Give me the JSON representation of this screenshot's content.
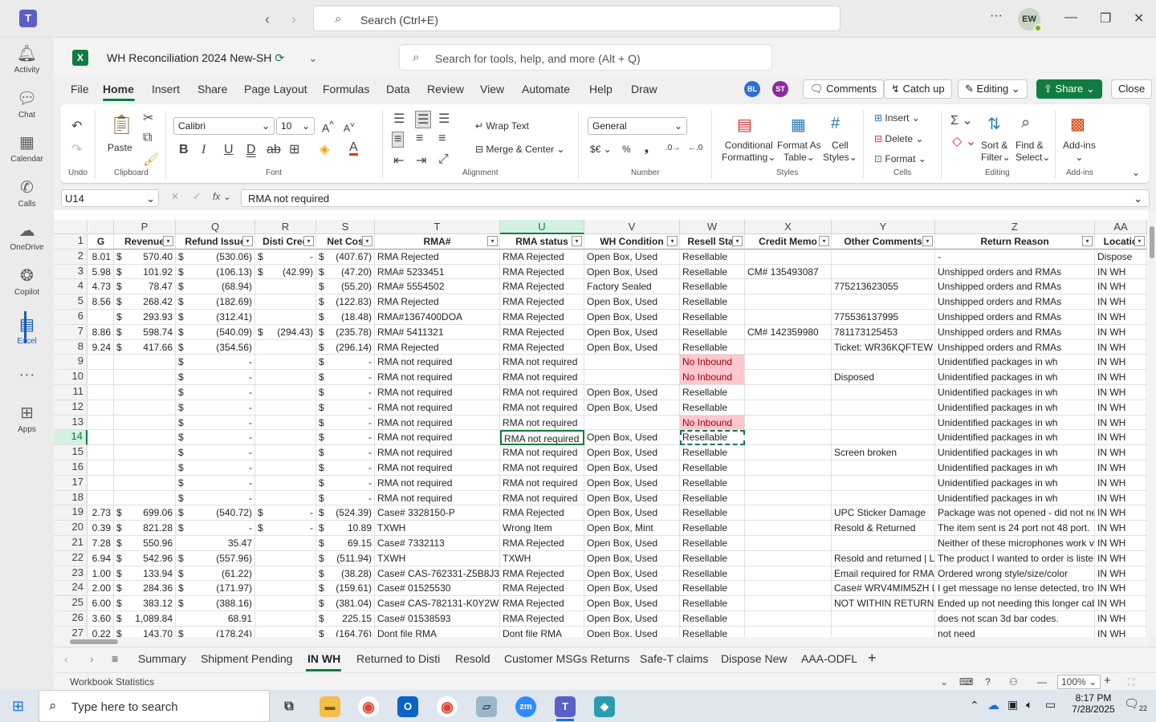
{
  "teams": {
    "search_placeholder": "Search (Ctrl+E)",
    "user_initials": "EW"
  },
  "rail": [
    {
      "label": "Activity",
      "icon": "bell-icon"
    },
    {
      "label": "Chat",
      "icon": "chat-icon"
    },
    {
      "label": "Calendar",
      "icon": "calendar-icon"
    },
    {
      "label": "Calls",
      "icon": "phone-icon"
    },
    {
      "label": "OneDrive",
      "icon": "cloud-icon"
    },
    {
      "label": "Copilot",
      "icon": "copilot-icon"
    },
    {
      "label": "Excel",
      "icon": "excel-icon"
    },
    {
      "label": "Apps",
      "icon": "apps-icon"
    }
  ],
  "workbook": {
    "title": "WH Reconciliation 2024 New-SH",
    "search_placeholder": "Search for tools, help, and more (Alt + Q)"
  },
  "ribbon_tabs": [
    "File",
    "Home",
    "Insert",
    "Share",
    "Page Layout",
    "Formulas",
    "Data",
    "Review",
    "View",
    "Automate",
    "Help",
    "Draw"
  ],
  "collab": {
    "avatar1": "BL",
    "avatar2": "ST",
    "comments": "Comments",
    "catchup": "Catch up",
    "editing": "Editing",
    "share": "Share",
    "close": "Close"
  },
  "ribbon": {
    "undo_group": "Undo",
    "paste": "Paste",
    "clipboard_group": "Clipboard",
    "font_name": "Calibri",
    "font_size": "10",
    "font_group": "Font",
    "wrap_text": "Wrap Text",
    "merge_center": "Merge & Center",
    "alignment_group": "Alignment",
    "number_format": "General",
    "number_group": "Number",
    "cond_format_1": "Conditional",
    "cond_format_2": "Formatting",
    "format_table_1": "Format As",
    "format_table_2": "Table",
    "cell_styles_1": "Cell",
    "cell_styles_2": "Styles",
    "styles_group": "Styles",
    "insert": "Insert",
    "delete": "Delete",
    "format": "Format",
    "cells_group": "Cells",
    "sort_1": "Sort &",
    "sort_2": "Filter",
    "find_1": "Find &",
    "find_2": "Select",
    "editing_group": "Editing",
    "addins": "Add-ins",
    "addins_group": "Add-ins"
  },
  "formula_bar": {
    "cell_ref": "U14",
    "content": "RMA not required"
  },
  "columns": [
    {
      "letter": "",
      "header": "G",
      "w": 32
    },
    {
      "letter": "P",
      "header": "Revenue",
      "w": 77
    },
    {
      "letter": "Q",
      "header": "Refund Issue",
      "w": 99
    },
    {
      "letter": "R",
      "header": "Disti Cred",
      "w": 76
    },
    {
      "letter": "S",
      "header": "Net Cos",
      "w": 73
    },
    {
      "letter": "T",
      "header": "RMA#",
      "w": 156
    },
    {
      "letter": "U",
      "header": "RMA status",
      "w": 105
    },
    {
      "letter": "V",
      "header": "WH Condition",
      "w": 119
    },
    {
      "letter": "W",
      "header": "Resell Stat",
      "w": 81
    },
    {
      "letter": "X",
      "header": "Credit Memo",
      "w": 108
    },
    {
      "letter": "Y",
      "header": "Other Comments",
      "w": 129
    },
    {
      "letter": "Z",
      "header": "Return Reason",
      "w": 199
    },
    {
      "letter": "AA",
      "header": "Locatio",
      "w": 65
    }
  ],
  "rows": [
    {
      "n": "2",
      "c": [
        "8.01",
        "570.40",
        "(530.06)",
        "-",
        "(407.67)",
        "RMA Rejected",
        "RMA Rejected",
        "Open Box, Used",
        "Resellable",
        "",
        "",
        "-",
        "Dispose"
      ],
      "d": [
        0,
        1,
        1,
        1,
        1
      ]
    },
    {
      "n": "3",
      "c": [
        "5.98",
        "101.92",
        "(106.13)",
        "(42.99)",
        "(47.20)",
        "RMA# 5233451",
        "RMA Rejected",
        "Open Box, Used",
        "Resellable",
        "CM# 135493087",
        "",
        "Unshipped orders and RMAs",
        "IN WH"
      ],
      "d": [
        0,
        1,
        1,
        1,
        1
      ]
    },
    {
      "n": "4",
      "c": [
        "4.73",
        "78.47",
        "(68.94)",
        "",
        "(55.20)",
        "RMA# 5554502",
        "RMA Rejected",
        "Factory Sealed",
        "Resellable",
        "",
        "775213623055",
        "Unshipped orders and RMAs",
        "IN WH"
      ],
      "d": [
        0,
        1,
        1,
        0,
        1
      ]
    },
    {
      "n": "5",
      "c": [
        "8.56",
        "268.42",
        "(182.69)",
        "",
        "(122.83)",
        "RMA Rejected",
        "RMA Rejected",
        "Open Box, Used",
        "Resellable",
        "",
        "",
        "Unshipped orders and RMAs",
        "IN WH"
      ],
      "d": [
        0,
        1,
        1,
        0,
        1
      ]
    },
    {
      "n": "6",
      "c": [
        "",
        "293.93",
        "(312.41)",
        "",
        "(18.48)",
        "RMA#1367400DOA",
        "RMA Rejected",
        "Open Box, Used",
        "Resellable",
        "",
        "775536137995",
        "Unshipped orders and RMAs",
        "IN WH"
      ],
      "d": [
        0,
        1,
        1,
        0,
        1
      ]
    },
    {
      "n": "7",
      "c": [
        "8.86",
        "598.74",
        "(540.09)",
        "(294.43)",
        "(235.78)",
        "RMA# 5411321",
        "RMA Rejected",
        "Open Box, Used",
        "Resellable",
        "CM# 142359980",
        "781173125453",
        "Unshipped orders and RMAs",
        "IN WH"
      ],
      "d": [
        0,
        1,
        1,
        1,
        1
      ]
    },
    {
      "n": "8",
      "c": [
        "9.24",
        "417.66",
        "(354.56)",
        "",
        "(296.14)",
        "RMA Rejected",
        "RMA Rejected",
        "Open Box, Used",
        "Resellable",
        "",
        "Ticket: WR36KQFTEW",
        "Unshipped orders and RMAs",
        "IN WH"
      ],
      "d": [
        0,
        1,
        1,
        0,
        1
      ]
    },
    {
      "n": "9",
      "c": [
        "",
        "",
        "-",
        "",
        "-",
        "RMA not required",
        "RMA not required",
        "",
        "No Inbound",
        "",
        "",
        "Unidentified packages in wh",
        "IN WH"
      ],
      "d": [
        0,
        0,
        1,
        0,
        1
      ]
    },
    {
      "n": "10",
      "c": [
        "",
        "",
        "-",
        "",
        "-",
        "RMA not required",
        "RMA not required",
        "",
        "No Inbound",
        "",
        "Disposed",
        "Unidentified packages in wh",
        "IN WH"
      ],
      "d": [
        0,
        0,
        1,
        0,
        1
      ]
    },
    {
      "n": "11",
      "c": [
        "",
        "",
        "-",
        "",
        "-",
        "RMA not required",
        "RMA not required",
        "Open Box, Used",
        "Resellable",
        "",
        "",
        "Unidentified packages in wh",
        "IN WH"
      ],
      "d": [
        0,
        0,
        1,
        0,
        1
      ]
    },
    {
      "n": "12",
      "c": [
        "",
        "",
        "-",
        "",
        "-",
        "RMA not required",
        "RMA not required",
        "Open Box, Used",
        "Resellable",
        "",
        "",
        "Unidentified packages in wh",
        "IN WH"
      ],
      "d": [
        0,
        0,
        1,
        0,
        1
      ]
    },
    {
      "n": "13",
      "c": [
        "",
        "",
        "-",
        "",
        "-",
        "RMA not required",
        "RMA not required",
        "",
        "No Inbound",
        "",
        "",
        "Unidentified packages in wh",
        "IN WH"
      ],
      "d": [
        0,
        0,
        1,
        0,
        1
      ]
    },
    {
      "n": "14",
      "c": [
        "",
        "",
        "-",
        "",
        "-",
        "RMA not required",
        "RMA not required",
        "Open Box, Used",
        "Resellable",
        "",
        "",
        "Unidentified packages in wh",
        "IN WH"
      ],
      "d": [
        0,
        0,
        1,
        0,
        1
      ]
    },
    {
      "n": "15",
      "c": [
        "",
        "",
        "-",
        "",
        "-",
        "RMA not required",
        "RMA not required",
        "Open Box, Used",
        "Resellable",
        "",
        "Screen broken",
        "Unidentified packages in wh",
        "IN WH"
      ],
      "d": [
        0,
        0,
        1,
        0,
        1
      ]
    },
    {
      "n": "16",
      "c": [
        "",
        "",
        "-",
        "",
        "-",
        "RMA not required",
        "RMA not required",
        "Open Box, Used",
        "Resellable",
        "",
        "",
        "Unidentified packages in wh",
        "IN WH"
      ],
      "d": [
        0,
        0,
        1,
        0,
        1
      ]
    },
    {
      "n": "17",
      "c": [
        "",
        "",
        "-",
        "",
        "-",
        "RMA not required",
        "RMA not required",
        "Open Box, Used",
        "Resellable",
        "",
        "",
        "Unidentified packages in wh",
        "IN WH"
      ],
      "d": [
        0,
        0,
        1,
        0,
        1
      ]
    },
    {
      "n": "18",
      "c": [
        "",
        "",
        "-",
        "",
        "-",
        "RMA not required",
        "RMA not required",
        "Open Box, Used",
        "Resellable",
        "",
        "",
        "Unidentified packages in wh",
        "IN WH"
      ],
      "d": [
        0,
        0,
        1,
        0,
        1
      ]
    },
    {
      "n": "19",
      "c": [
        "2.73",
        "699.06",
        "(540.72)",
        "-",
        "(524.39)",
        "Case# 3328150-P",
        "RMA Rejected",
        "Open Box, Used",
        "Resellable",
        "",
        "UPC Sticker Damage",
        "Package was not opened - did not ne",
        "IN WH"
      ],
      "d": [
        0,
        1,
        1,
        1,
        1
      ]
    },
    {
      "n": "20",
      "c": [
        "0.39",
        "821.28",
        "-",
        "-",
        "10.89",
        "TXWH",
        "Wrong Item",
        "Open Box, Mint",
        "Resellable",
        "",
        "Resold & Returned",
        "The item sent is 24 port not 48 port.",
        "IN WH"
      ],
      "d": [
        0,
        1,
        1,
        1,
        1
      ]
    },
    {
      "n": "21",
      "c": [
        "7.28",
        "550.96",
        "35.47",
        "",
        "69.15",
        "Case# 7332113",
        "RMA Rejected",
        "Open Box, Used",
        "Resellable",
        "",
        "",
        "Neither of these microphones work v",
        "IN WH"
      ],
      "d": [
        0,
        1,
        0,
        0,
        1
      ]
    },
    {
      "n": "22",
      "c": [
        "6.94",
        "542.96",
        "(557.96)",
        "",
        "(511.94)",
        "TXWH",
        "TXWH",
        "Open Box, Used",
        "Resellable",
        "",
        "Resold and returned | L",
        "The product I wanted to order is liste",
        "IN WH"
      ],
      "d": [
        0,
        1,
        1,
        0,
        1
      ]
    },
    {
      "n": "23",
      "c": [
        "1.00",
        "133.94",
        "(61.22)",
        "",
        "(38.28)",
        "Case# CAS-762331-Z5B8J3-1",
        "RMA Rejected",
        "Open Box, Used",
        "Resellable",
        "",
        "Email required for RMA",
        "Ordered wrong style/size/color",
        "IN WH"
      ],
      "d": [
        0,
        1,
        1,
        0,
        1
      ]
    },
    {
      "n": "24",
      "c": [
        "2.00",
        "284.36",
        "(171.97)",
        "",
        "(159.61)",
        "Case# 01525530",
        "RMA Rejected",
        "Open Box, Used",
        "Resellable",
        "",
        "Case# WRV4MIM5ZH  L",
        "I get message no lense detected, trou",
        "IN WH"
      ],
      "d": [
        0,
        1,
        1,
        0,
        1
      ]
    },
    {
      "n": "25",
      "c": [
        "6.00",
        "383.12",
        "(388.16)",
        "",
        "(381.04)",
        "Case# CAS-782131-K0Y2W6-",
        "RMA Rejected",
        "Open Box, Used",
        "Resellable",
        "",
        "NOT WITHIN RETURN P",
        "Ended up not needing this longer cab",
        "IN WH"
      ],
      "d": [
        0,
        1,
        1,
        0,
        1
      ]
    },
    {
      "n": "26",
      "c": [
        "3.60",
        "1,089.84",
        "68.91",
        "",
        "225.15",
        "Case# 01538593",
        "RMA Rejected",
        "Open Box, Used",
        "Resellable",
        "",
        "",
        "does not scan 3d bar codes.",
        "IN WH"
      ],
      "d": [
        0,
        1,
        0,
        0,
        1
      ]
    },
    {
      "n": "27",
      "c": [
        "0.22",
        "143.70",
        "(178.24)",
        "",
        "(164.76)",
        "Dont file RMA",
        "Dont file RMA",
        "Open Box, Used",
        "Resellable",
        "",
        "",
        "not need",
        "IN WH"
      ],
      "d": [
        0,
        1,
        1,
        0,
        1
      ]
    }
  ],
  "sheet_tabs": [
    "Summary",
    "Shipment Pending",
    "IN WH",
    "Returned to Disti",
    "Resold",
    "Customer MSGs Returns",
    "Safe-T claims",
    "Dispose New",
    "AAA-ODFL"
  ],
  "status": {
    "left": "Workbook Statistics",
    "zoom": "100%"
  },
  "taskbar": {
    "search_placeholder": "Type here to search",
    "time": "8:17 PM",
    "date": "7/28/2025",
    "notifications": "22"
  },
  "colors": {
    "excel_green": "#107c41",
    "no_inbound_bg": "#ffc7ce",
    "no_inbound_fg": "#9c0006"
  }
}
